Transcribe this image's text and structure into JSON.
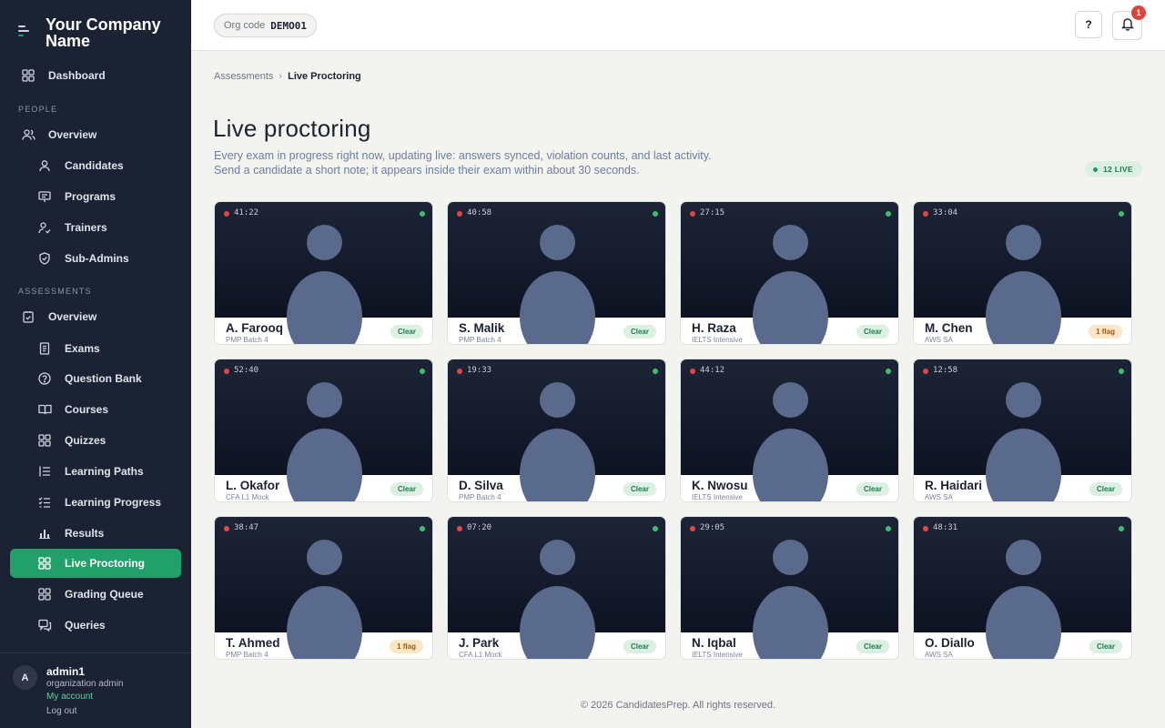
{
  "brand": {
    "name": "Your Company Name"
  },
  "nav": {
    "dashboard": "Dashboard",
    "people_label": "PEOPLE",
    "people_overview": "Overview",
    "candidates": "Candidates",
    "programs": "Programs",
    "trainers": "Trainers",
    "subadmins": "Sub-Admins",
    "assessments_label": "ASSESSMENTS",
    "assessments_overview": "Overview",
    "exams": "Exams",
    "question_bank": "Question Bank",
    "courses": "Courses",
    "quizzes": "Quizzes",
    "learning_paths": "Learning Paths",
    "learning_progress": "Learning Progress",
    "results": "Results",
    "live_proctoring": "Live Proctoring",
    "grading_queue": "Grading Queue",
    "queries": "Queries"
  },
  "user": {
    "initial": "A",
    "name": "admin1",
    "role": "organization admin",
    "account_link": "My account",
    "logout": "Log out"
  },
  "topbar": {
    "org_label": "Org code",
    "org_code": "DEMO01",
    "help": "?",
    "notification_count": "1"
  },
  "breadcrumb": {
    "parent": "Assessments",
    "sep": "›",
    "current": "Live Proctoring"
  },
  "page": {
    "title": "Live proctoring",
    "desc_line1": "Every exam in progress right now, updating live: answers synced, violation counts, and last activity.",
    "desc_line2": "Send a candidate a short note; it appears inside their exam within about 30 seconds.",
    "live_count": "12 LIVE"
  },
  "candidates": [
    {
      "timer": "41:22",
      "name": "A. Farooq",
      "batch": "PMP Batch 4",
      "status": "Clear",
      "flagged": false
    },
    {
      "timer": "40:58",
      "name": "S. Malik",
      "batch": "PMP Batch 4",
      "status": "Clear",
      "flagged": false
    },
    {
      "timer": "27:15",
      "name": "H. Raza",
      "batch": "IELTS Intensive",
      "status": "Clear",
      "flagged": false
    },
    {
      "timer": "33:04",
      "name": "M. Chen",
      "batch": "AWS SA",
      "status": "1 flag",
      "flagged": true
    },
    {
      "timer": "52:40",
      "name": "L. Okafor",
      "batch": "CFA L1 Mock",
      "status": "Clear",
      "flagged": false
    },
    {
      "timer": "19:33",
      "name": "D. Silva",
      "batch": "PMP Batch 4",
      "status": "Clear",
      "flagged": false
    },
    {
      "timer": "44:12",
      "name": "K. Nwosu",
      "batch": "IELTS Intensive",
      "status": "Clear",
      "flagged": false
    },
    {
      "timer": "12:58",
      "name": "R. Haidari",
      "batch": "AWS SA",
      "status": "Clear",
      "flagged": false
    },
    {
      "timer": "38:47",
      "name": "T. Ahmed",
      "batch": "PMP Batch 4",
      "status": "1 flag",
      "flagged": true
    },
    {
      "timer": "07:20",
      "name": "J. Park",
      "batch": "CFA L1 Mock",
      "status": "Clear",
      "flagged": false
    },
    {
      "timer": "29:05",
      "name": "N. Iqbal",
      "batch": "IELTS Intensive",
      "status": "Clear",
      "flagged": false
    },
    {
      "timer": "48:31",
      "name": "O. Diallo",
      "batch": "AWS SA",
      "status": "Clear",
      "flagged": false
    }
  ],
  "footer": {
    "text": "© 2026 CandidatesPrep. All rights reserved."
  }
}
